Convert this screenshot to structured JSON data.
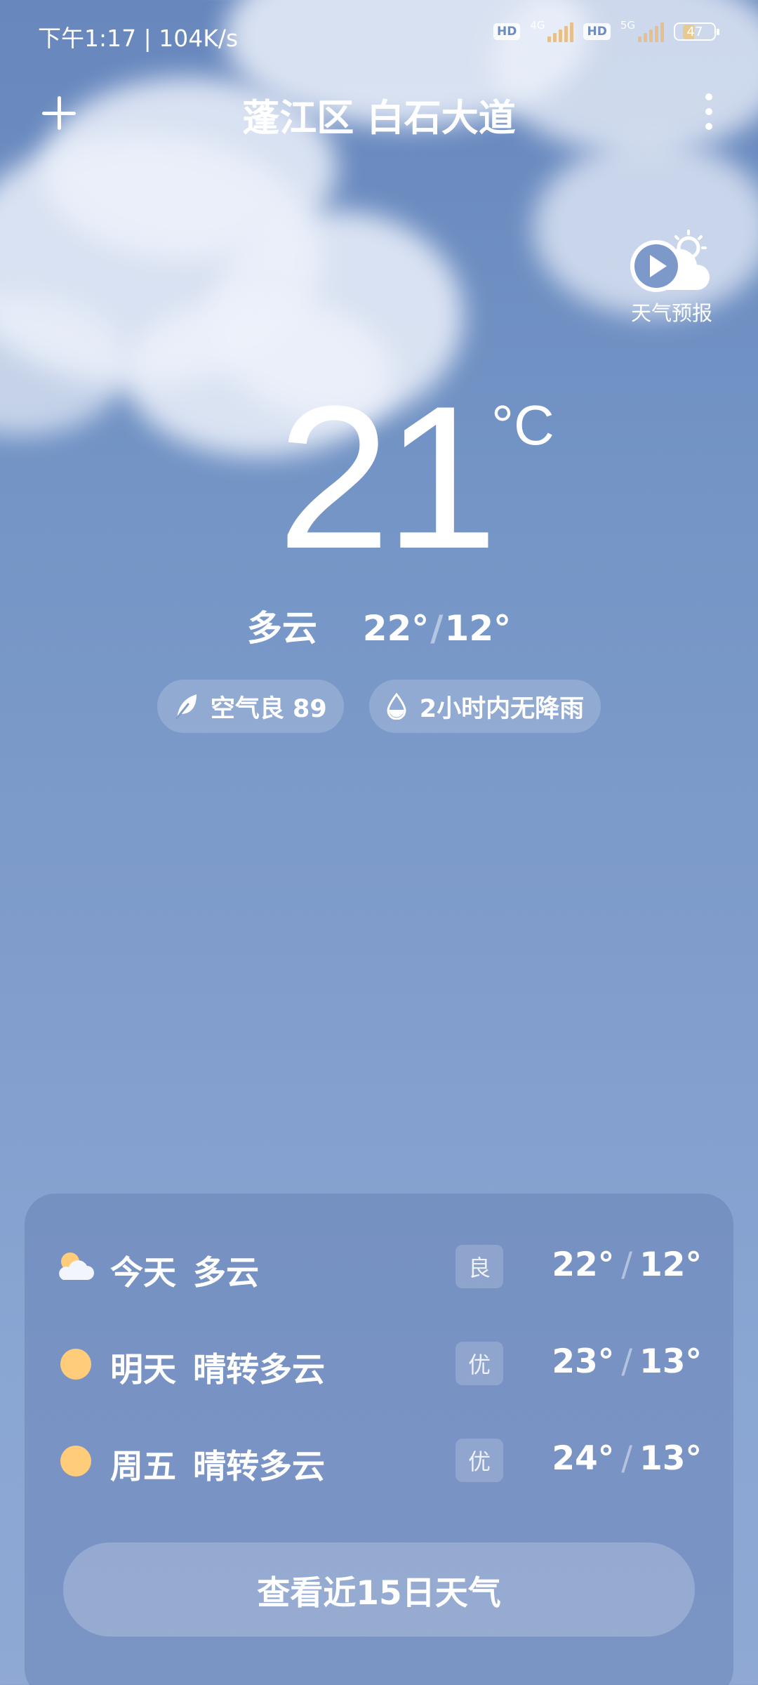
{
  "status_bar": {
    "time_speed": "下午1:17 | 104K/s",
    "hd1": "HD",
    "net1": "4G",
    "hd2": "HD",
    "net2": "5G",
    "battery": "47"
  },
  "header": {
    "location": "蓬江区 白石大道"
  },
  "weather_video": {
    "label": "天气预报",
    "icon": "play-cloud-sun-icon"
  },
  "current": {
    "temperature": "21",
    "unit": "°C",
    "condition": "多云",
    "high": "22°",
    "low": "12°"
  },
  "pills": {
    "air_quality": "空气良 89",
    "rain": "2小时内无降雨"
  },
  "forecast": [
    {
      "icon": "partly-cloudy-icon",
      "day": "今天",
      "condition": "多云",
      "aqi": "良",
      "high": "22°",
      "low": "12°"
    },
    {
      "icon": "sun-icon",
      "day": "明天",
      "condition": "晴转多云",
      "aqi": "优",
      "high": "23°",
      "low": "13°"
    },
    {
      "icon": "sun-icon",
      "day": "周五",
      "condition": "晴转多云",
      "aqi": "优",
      "high": "24°",
      "low": "13°"
    }
  ],
  "cta_label": "查看近15日天气",
  "colors": {
    "sky_top": "#6787bd",
    "sky_bottom": "#8fa9d4",
    "sun": "#ffcd7a"
  }
}
